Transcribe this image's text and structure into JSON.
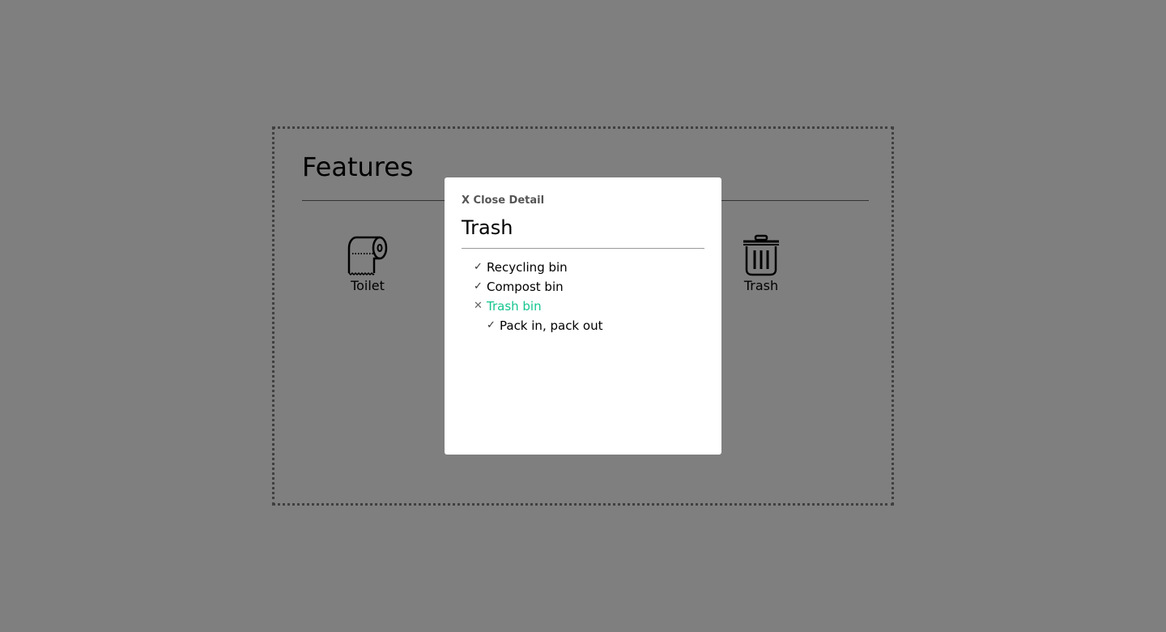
{
  "features": {
    "title": "Features",
    "items": [
      {
        "label": "Toilet",
        "icon": "toilet-paper-icon"
      },
      {
        "label": "Trash",
        "icon": "trash-can-icon"
      }
    ]
  },
  "modal": {
    "close_label": "X Close Detail",
    "title": "Trash",
    "options": [
      {
        "label": "Recycling bin",
        "mark": "✓",
        "status": "available",
        "nested": false
      },
      {
        "label": "Compost bin",
        "mark": "✓",
        "status": "available",
        "nested": false
      },
      {
        "label": "Trash bin",
        "mark": "✕",
        "status": "unavailable",
        "nested": false
      },
      {
        "label": "Pack in, pack out",
        "mark": "✓",
        "status": "available",
        "nested": true
      }
    ]
  },
  "colors": {
    "overlay": "rgba(0,0,0,0.5)",
    "unavailable_text": "#14c58f"
  }
}
